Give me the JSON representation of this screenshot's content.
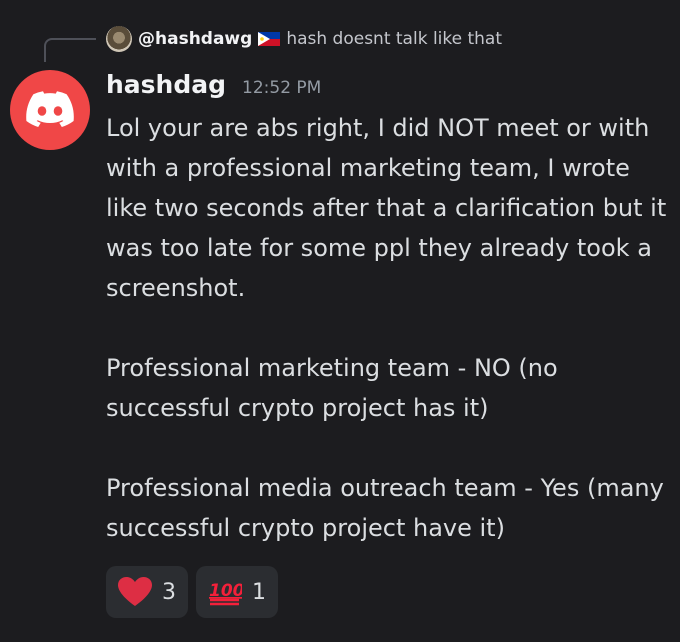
{
  "reply": {
    "username": "@hashdawg",
    "text": "hash doesnt talk like that",
    "avatar_icon": "profile-photo",
    "flag_icon": "philippines-flag"
  },
  "message": {
    "author": "hashdag",
    "timestamp": "12:52 PM",
    "avatar_icon": "discord-logo",
    "avatar_color": "#f04747",
    "paragraphs": [
      "Lol your are abs right, I did NOT meet or with with a professional marketing team, I wrote like two seconds after that a clarification but it was too late for some ppl they already took a screenshot.",
      "Professional marketing team - NO (no successful crypto project has it)",
      "Professional media outreach team - Yes (many successful crypto project have it)"
    ]
  },
  "reactions": [
    {
      "emoji": "red-heart",
      "count": "3"
    },
    {
      "emoji": "hundred-points",
      "count": "1"
    }
  ]
}
